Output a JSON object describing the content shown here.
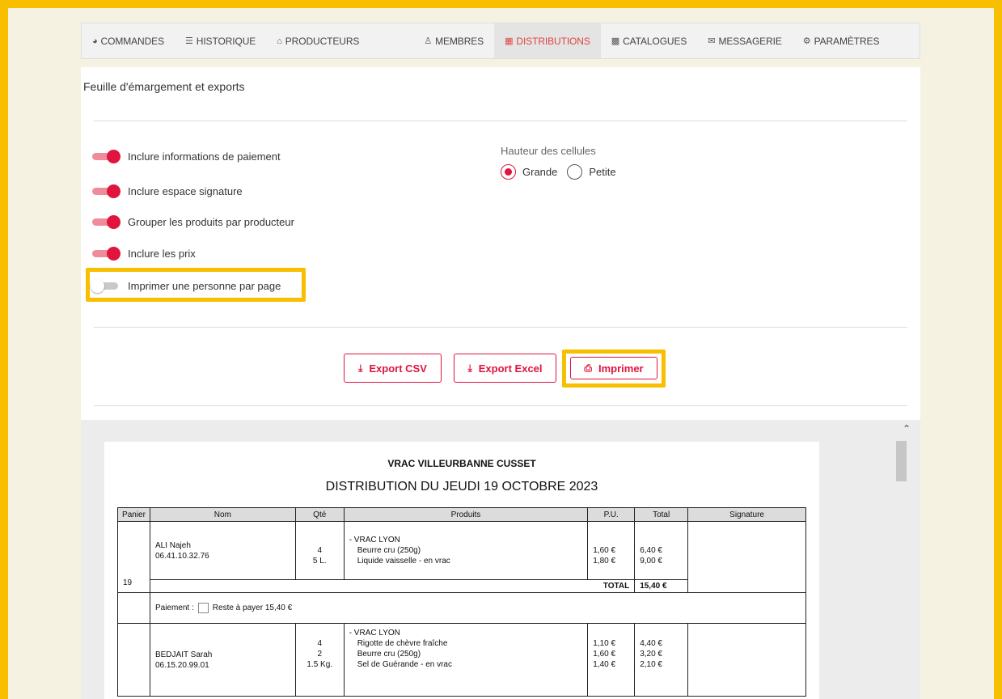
{
  "nav": {
    "commandes": "COMMANDES",
    "historique": "HISTORIQUE",
    "producteurs": "PRODUCTEURS",
    "membres": "MEMBRES",
    "distributions": "DISTRIBUTIONS",
    "catalogues": "CATALOGUES",
    "messagerie": "MESSAGERIE",
    "parametres": "PARAMÈTRES"
  },
  "panel": {
    "title": "Feuille d'émargement et exports",
    "toggles": [
      {
        "label": "Inclure informations de paiement",
        "on": true
      },
      {
        "label": "Inclure espace signature",
        "on": true
      },
      {
        "label": "Grouper les produits par producteur",
        "on": true
      },
      {
        "label": "Inclure les prix",
        "on": true
      },
      {
        "label": "Imprimer une personne par page",
        "on": false
      }
    ],
    "cell_height_label": "Hauteur des cellules",
    "radio_grande": "Grande",
    "radio_petite": "Petite",
    "selected_height": "Grande",
    "btn_csv": "Export CSV",
    "btn_excel": "Export Excel",
    "btn_print": "Imprimer"
  },
  "sheet": {
    "org": "VRAC VILLEURBANNE CUSSET",
    "title": "DISTRIBUTION DU JEUDI 19 OCTOBRE 2023",
    "headers": {
      "panier": "Panier",
      "nom": "Nom",
      "qte": "Qté",
      "produits": "Produits",
      "pu": "P.U.",
      "total": "Total",
      "signature": "Signature"
    },
    "rows": [
      {
        "panier": "19",
        "name": "ALI Najeh",
        "phone": "06.41.10.32.76",
        "producer": "- VRAC LYON",
        "qtys": [
          "4",
          "5 L."
        ],
        "products": [
          "Beurre cru (250g)",
          "Liquide vaisselle - en vrac"
        ],
        "pus": [
          "1,60 €",
          "1,80 €"
        ],
        "totals": [
          "6,40 €",
          "9,00 €"
        ],
        "total_label": "TOTAL",
        "total_value": "15,40 €",
        "payment_label": "Paiement :",
        "payment_text": "Reste à payer 15,40 €"
      },
      {
        "name": "BEDJAIT Sarah",
        "phone": "06.15.20.99.01",
        "producer": "- VRAC LYON",
        "qtys": [
          "4",
          "2",
          "1.5 Kg."
        ],
        "products": [
          "Rigotte de chèvre fraîche",
          "Beurre cru (250g)",
          "Sel de Guérande - en vrac"
        ],
        "pus": [
          "1,10 €",
          "1,60 €",
          "1,40 €"
        ],
        "totals": [
          "4,40 €",
          "3,20 €",
          "2,10 €"
        ]
      }
    ]
  },
  "colors": {
    "accent": "#e0143c",
    "highlight": "#f8be00",
    "toggle_track": "#ee8d99"
  }
}
